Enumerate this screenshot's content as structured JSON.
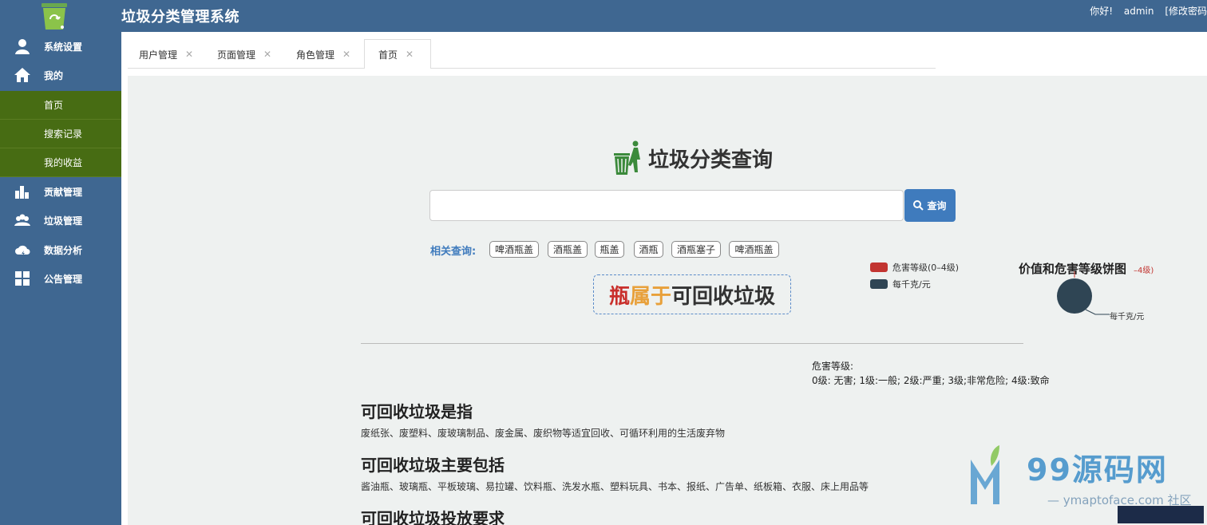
{
  "app": {
    "title": "垃圾分类管理系统"
  },
  "user": {
    "greeting": "你好!",
    "name": "admin",
    "change_password": "[修改密码"
  },
  "sidebar": {
    "items": [
      {
        "label": "系统设置",
        "icon": "user-icon"
      },
      {
        "label": "我的",
        "icon": "home-icon"
      },
      {
        "label": "贡献管理",
        "icon": "bar-chart-icon"
      },
      {
        "label": "垃圾管理",
        "icon": "users-icon"
      },
      {
        "label": "数据分析",
        "icon": "cloud-icon"
      },
      {
        "label": "公告管理",
        "icon": "grid-icon"
      }
    ],
    "sub_items": [
      "首页",
      "搜索记录",
      "我的收益"
    ]
  },
  "tabs": [
    {
      "label": "用户管理"
    },
    {
      "label": "页面管理"
    },
    {
      "label": "角色管理"
    },
    {
      "label": "首页",
      "active": true
    }
  ],
  "search": {
    "title": "垃圾分类查询",
    "input_value": "",
    "input_placeholder": "",
    "button_label": "查询"
  },
  "related": {
    "label": "相关查询:",
    "chips": [
      "啤酒瓶盖",
      "酒瓶盖",
      "瓶盖",
      "酒瓶",
      "酒瓶塞子",
      "啤酒瓶盖"
    ]
  },
  "result": {
    "item": "瓶",
    "connector": "属于",
    "category": "可回收垃圾"
  },
  "pie_chart": {
    "title": "价值和危害等级饼图",
    "legend": [
      {
        "label": "危害等级(0–4级)",
        "color": "#c23531"
      },
      {
        "label": "每千克/元",
        "color": "#2f4554"
      }
    ],
    "label_hazard": "–4级)",
    "label_value": "每千克/元"
  },
  "hazard": {
    "title": "危害等级:",
    "scale": "0级: 无害; 1级:一般; 2级:严重; 3级;非常危险; 4级:致命"
  },
  "sections": [
    {
      "heading": "可回收垃圾是指",
      "text": "废纸张、废塑料、废玻璃制品、废金属、废织物等适宜回收、可循环利用的生活废弃物"
    },
    {
      "heading": "可回收垃圾主要包括",
      "text": "酱油瓶、玻璃瓶、平板玻璃、易拉罐、饮料瓶、洗发水瓶、塑料玩具、书本、报纸、广告单、纸板箱、衣服、床上用品等"
    },
    {
      "heading": "可回收垃圾投放要求",
      "text": ""
    }
  ],
  "watermark": {
    "text": "99源码网",
    "url": "— ymaptoface.com 社区"
  },
  "colors": {
    "header": "#3f6791",
    "sidebar_sub": "#476c13",
    "primary_button": "#3f7bbd",
    "main_bg": "#eef1f0"
  }
}
